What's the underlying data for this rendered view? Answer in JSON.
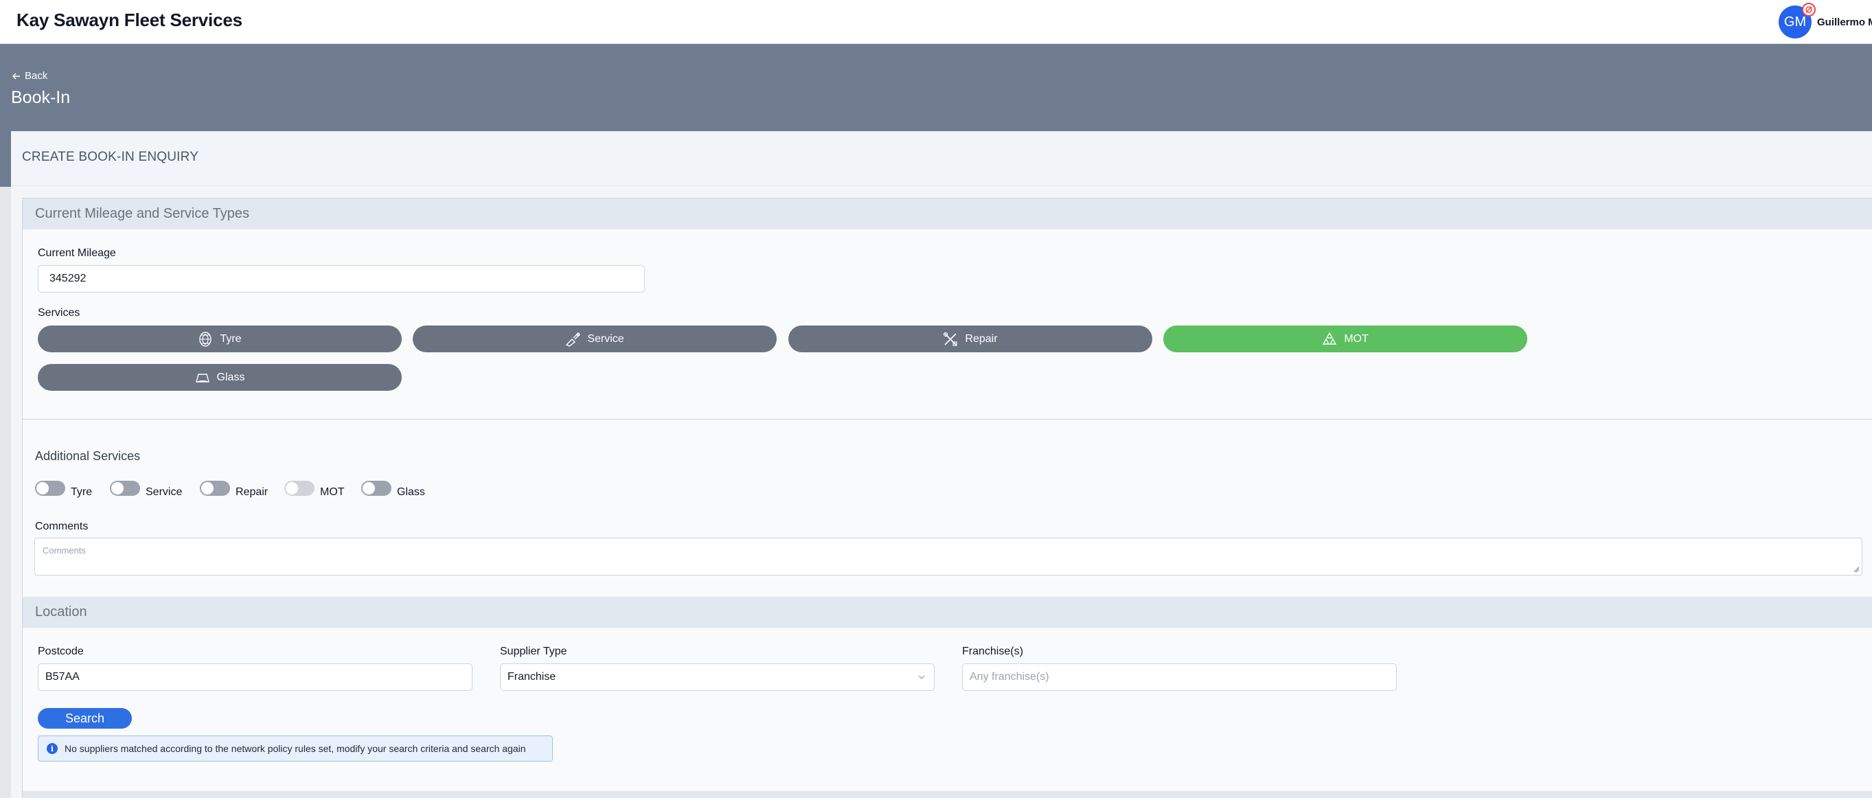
{
  "app": {
    "title": "Kay Sawayn Fleet Services"
  },
  "user": {
    "initials": "GM",
    "name": "Guillermo M"
  },
  "nav": {
    "back_label": "Back"
  },
  "page": {
    "title": "Book-In"
  },
  "card": {
    "title": "CREATE BOOK-IN ENQUIRY"
  },
  "mileage_section": {
    "heading": "Current Mileage and Service Types",
    "mileage_label": "Current Mileage",
    "mileage_value": "345292",
    "services_label": "Services",
    "services": [
      {
        "label": "Tyre",
        "icon": "tyre-icon",
        "selected": false
      },
      {
        "label": "Service",
        "icon": "service-icon",
        "selected": false
      },
      {
        "label": "Repair",
        "icon": "repair-icon",
        "selected": false
      },
      {
        "label": "MOT",
        "icon": "mot-icon",
        "selected": true
      },
      {
        "label": "Glass",
        "icon": "glass-icon",
        "selected": false
      }
    ],
    "selected_color": "#5cbf60",
    "unselected_color": "#6b7280"
  },
  "additional_services": {
    "heading": "Additional Services",
    "items": [
      {
        "label": "Tyre",
        "on": false,
        "disabled": false
      },
      {
        "label": "Service",
        "on": false,
        "disabled": false
      },
      {
        "label": "Repair",
        "on": false,
        "disabled": false
      },
      {
        "label": "MOT",
        "on": false,
        "disabled": true
      },
      {
        "label": "Glass",
        "on": false,
        "disabled": false
      }
    ]
  },
  "comments": {
    "label": "Comments",
    "placeholder": "Comments",
    "value": ""
  },
  "location": {
    "heading": "Location",
    "postcode_label": "Postcode",
    "postcode_value": "B57AA",
    "supplier_type_label": "Supplier Type",
    "supplier_type_value": "Franchise",
    "franchise_label": "Franchise(s)",
    "franchise_placeholder": "Any franchise(s)",
    "search_label": "Search"
  },
  "alert": {
    "icon": "info-icon",
    "message": "No suppliers matched according to the network policy rules set, modify your search criteria and search again"
  }
}
